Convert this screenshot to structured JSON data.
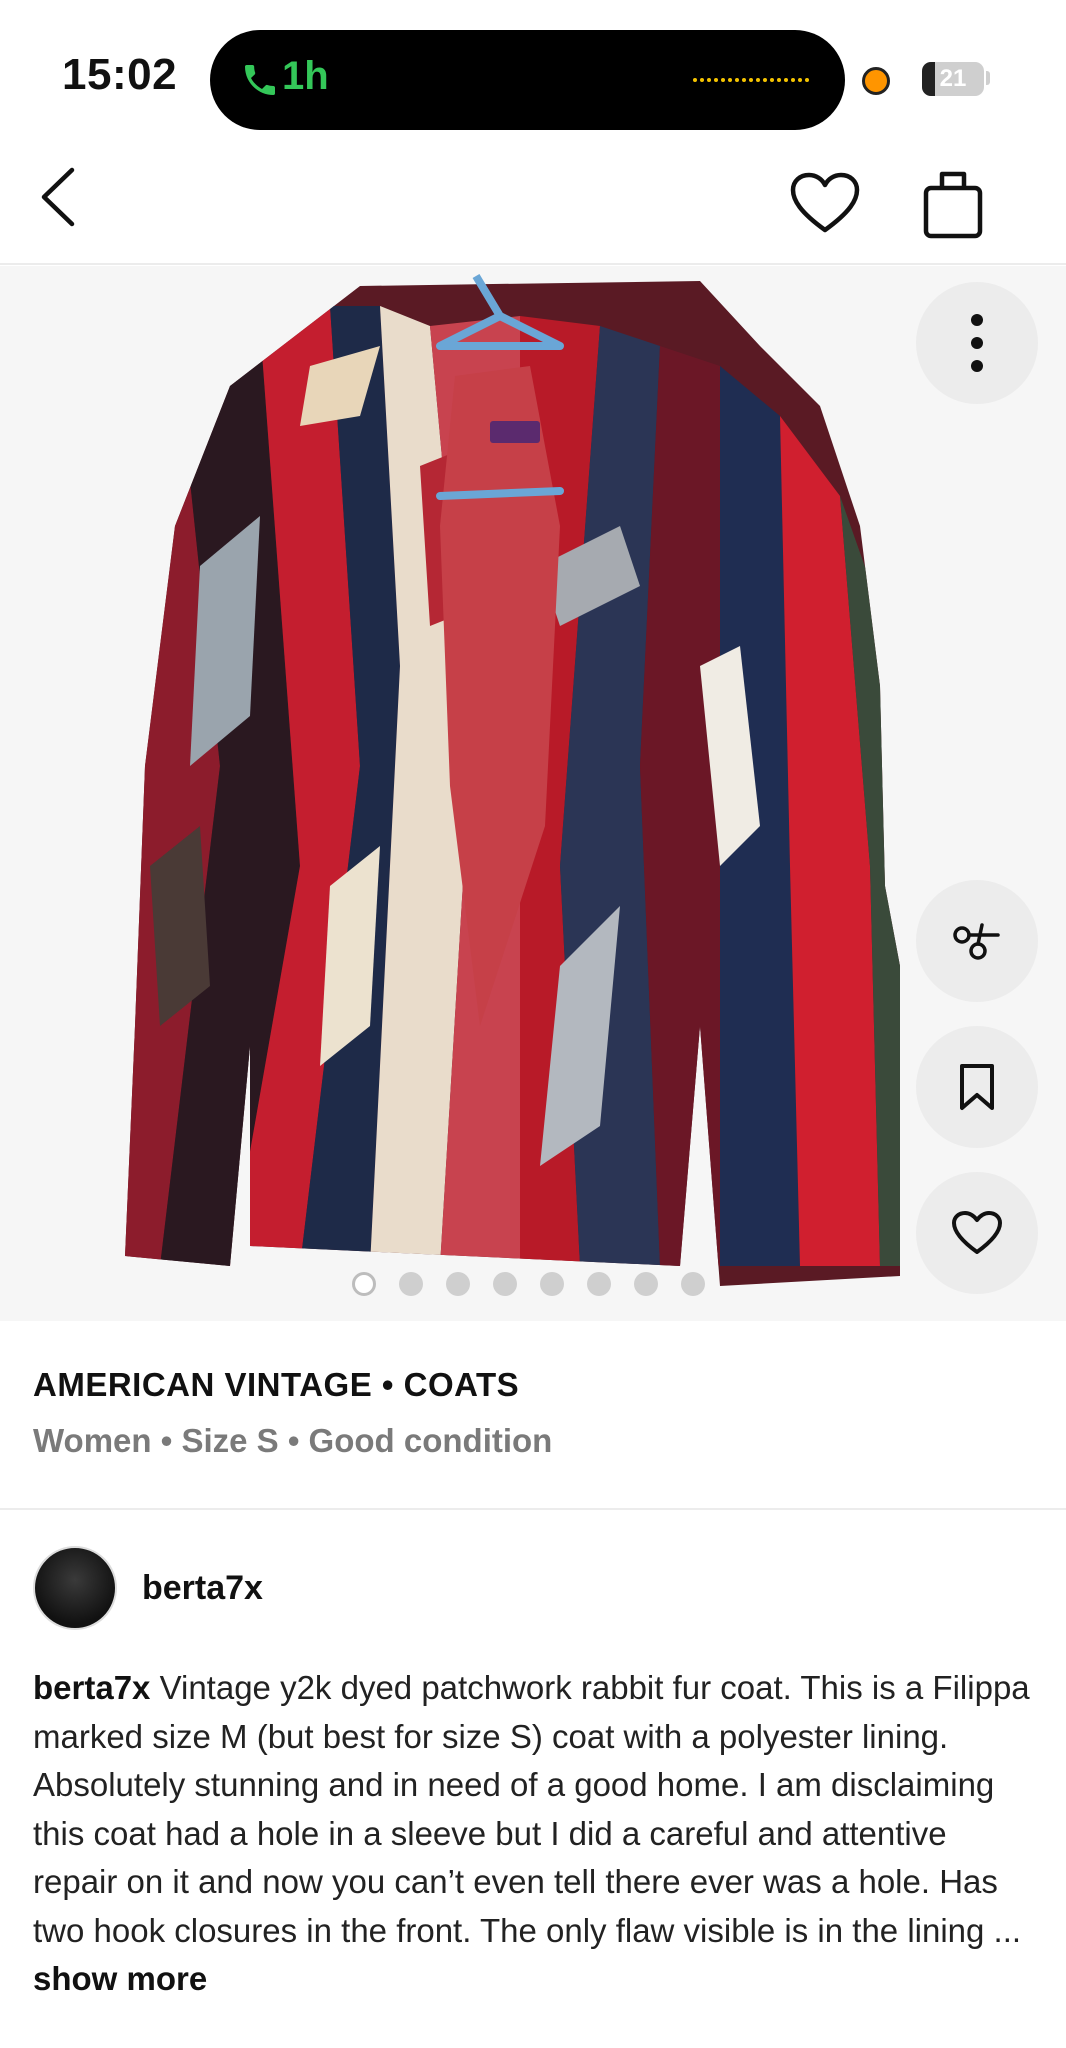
{
  "status_bar": {
    "time": "15:02",
    "call_duration": "1h",
    "battery": "21"
  },
  "nav": {
    "back_icon": "chevron-left-icon",
    "like_icon": "heart-icon",
    "bag_icon": "shopping-bag-icon"
  },
  "gallery": {
    "image_alt": "Multicolor patchwork rabbit fur coat on hanger",
    "page_count": 8,
    "current_page": 1,
    "actions": [
      "more-vertical-icon",
      "share-icon",
      "bookmark-icon",
      "heart-icon"
    ]
  },
  "product": {
    "brand_category": "AMERICAN VINTAGE • COATS",
    "meta": "Women • Size S • Good condition"
  },
  "seller": {
    "username": "berta7x"
  },
  "description": {
    "username": "berta7x",
    "text": " Vintage y2k dyed patchwork rabbit fur coat. This is a Filippa marked size M (but best for size S) coat with a polyester lining. Absolutely stunning and in need of a good home. I am disclaiming this coat had a hole in a sleeve but I did a careful and attentive repair on it and now you can’t even tell there ever was a hole. Has two hook closures in the front. The only flaw visible is in the lining ... ",
    "show_more": "show more"
  },
  "colors": {
    "call_green": "#34c759",
    "muted_text": "#7a7a7a"
  }
}
